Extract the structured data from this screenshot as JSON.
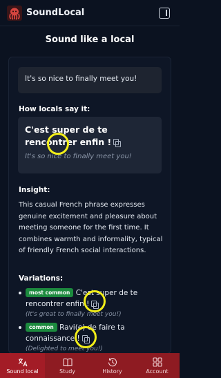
{
  "header": {
    "app_name": "SoundLocal"
  },
  "page": {
    "title": "Sound like a local"
  },
  "input": {
    "text": "It's so nice to finally meet you!"
  },
  "translation": {
    "label": "How locals say it:",
    "text": "C'est super de te rencontrer enfin !",
    "meaning": "It's so nice to finally meet you!"
  },
  "insight": {
    "label": "Insight:",
    "text": "This casual French phrase expresses genuine excitement and pleasure about meeting someone for the first time. It combines warmth and informality, typical of friendly French social interactions."
  },
  "variations": {
    "label": "Variations:",
    "items": [
      {
        "badge": "most common",
        "text": "C'est super de te rencontrer enfin !",
        "meaning": "(It's great to finally meet you!)"
      },
      {
        "badge": "common",
        "text": "Ravi(e) de faire ta connaissance !",
        "meaning": "(Delighted to meet you!)"
      }
    ]
  },
  "nav": {
    "items": [
      {
        "label": "Sound local",
        "icon": "translate-icon",
        "active": true
      },
      {
        "label": "Study",
        "icon": "book-icon",
        "active": false
      },
      {
        "label": "History",
        "icon": "history-icon",
        "active": false
      },
      {
        "label": "Account",
        "icon": "grid-icon",
        "active": false
      }
    ]
  },
  "colors": {
    "nav_bg": "#8e1b22",
    "badge_green": "#1c8a3e",
    "highlight": "#f2ee18"
  }
}
